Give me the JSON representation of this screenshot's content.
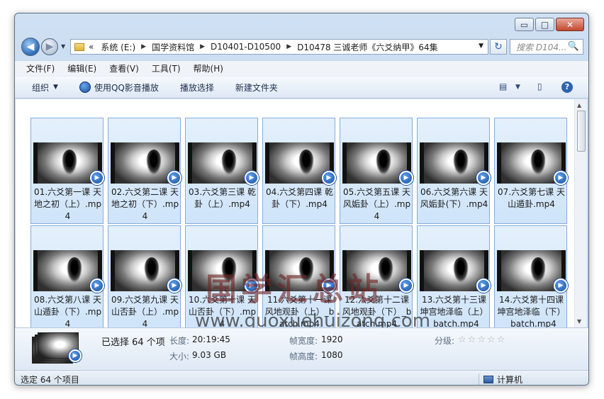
{
  "window": {
    "minimize": "▭",
    "maximize": "□",
    "close": "✕"
  },
  "nav": {
    "back_icon": "◀",
    "fwd_icon": "▶",
    "drop": "▼"
  },
  "address": {
    "chevrons": "«",
    "crumbs": [
      "系统 (E:)",
      "国学资料馆",
      "D10401-D10500",
      "D10478 三诚老师《六爻纳甲》64集"
    ],
    "sep": "▶",
    "dropdown": "▼"
  },
  "refresh_icon": "↻",
  "search": {
    "placeholder": "搜索 D104...",
    "icon": "🔍"
  },
  "menu": [
    "文件(F)",
    "编辑(E)",
    "查看(V)",
    "工具(T)",
    "帮助(H)"
  ],
  "toolbar": {
    "organize": "组织",
    "organize_caret": "▼",
    "qq_play": "使用QQ影音播放",
    "play_selection": "播放选择",
    "new_folder": "新建文件夹",
    "view_icon": "▤",
    "view_caret": "▼",
    "pane_icon": "▯",
    "help_icon": "?"
  },
  "files": [
    "01.六爻第一课 天地之初（上）.mp4",
    "02.六爻第二课 天地之初（下）.mp4",
    "03.六爻第三课 乾卦（上）.mp4",
    "04.六爻第四课 乾卦（下）.mp4",
    "05.六爻第五课 天风姤卦（上）.mp4",
    "06.六爻第六课 天风姤卦(下）.mp4",
    "07.六爻第七课 天山遁卦.mp4",
    "08.六爻第八课 天山遁卦（下）.mp4",
    "09.六爻第九课 天山否卦（上）.mp4",
    "10.六爻第十课 天山否卦（下）.mp4",
    "11.六爻第十一课 风地观卦（上）_batch.mp4",
    "12.六爻第十二课 风地观卦（下）_batch.mp4",
    "13.六爻第十三课 坤宫地泽临（上）_batch.mp4",
    "14.六爻第十四课 坤宫地泽临（下）_batch.mp4"
  ],
  "video_badge": "▶",
  "watermark": {
    "cn": "国学汇总站",
    "url": "www.guoxuehuizong.com"
  },
  "details": {
    "selected": "已选择 64 个项",
    "length_label": "长度:",
    "length": "20:19:45",
    "size_label": "大小:",
    "size": "9.03 GB",
    "width_label": "帧宽度:",
    "width": "1920",
    "height_label": "帧高度:",
    "height": "1080",
    "rating_label": "分级:",
    "stars": "☆☆☆☆☆"
  },
  "status": {
    "left": "选定 64 个项目",
    "right": "计算机"
  }
}
